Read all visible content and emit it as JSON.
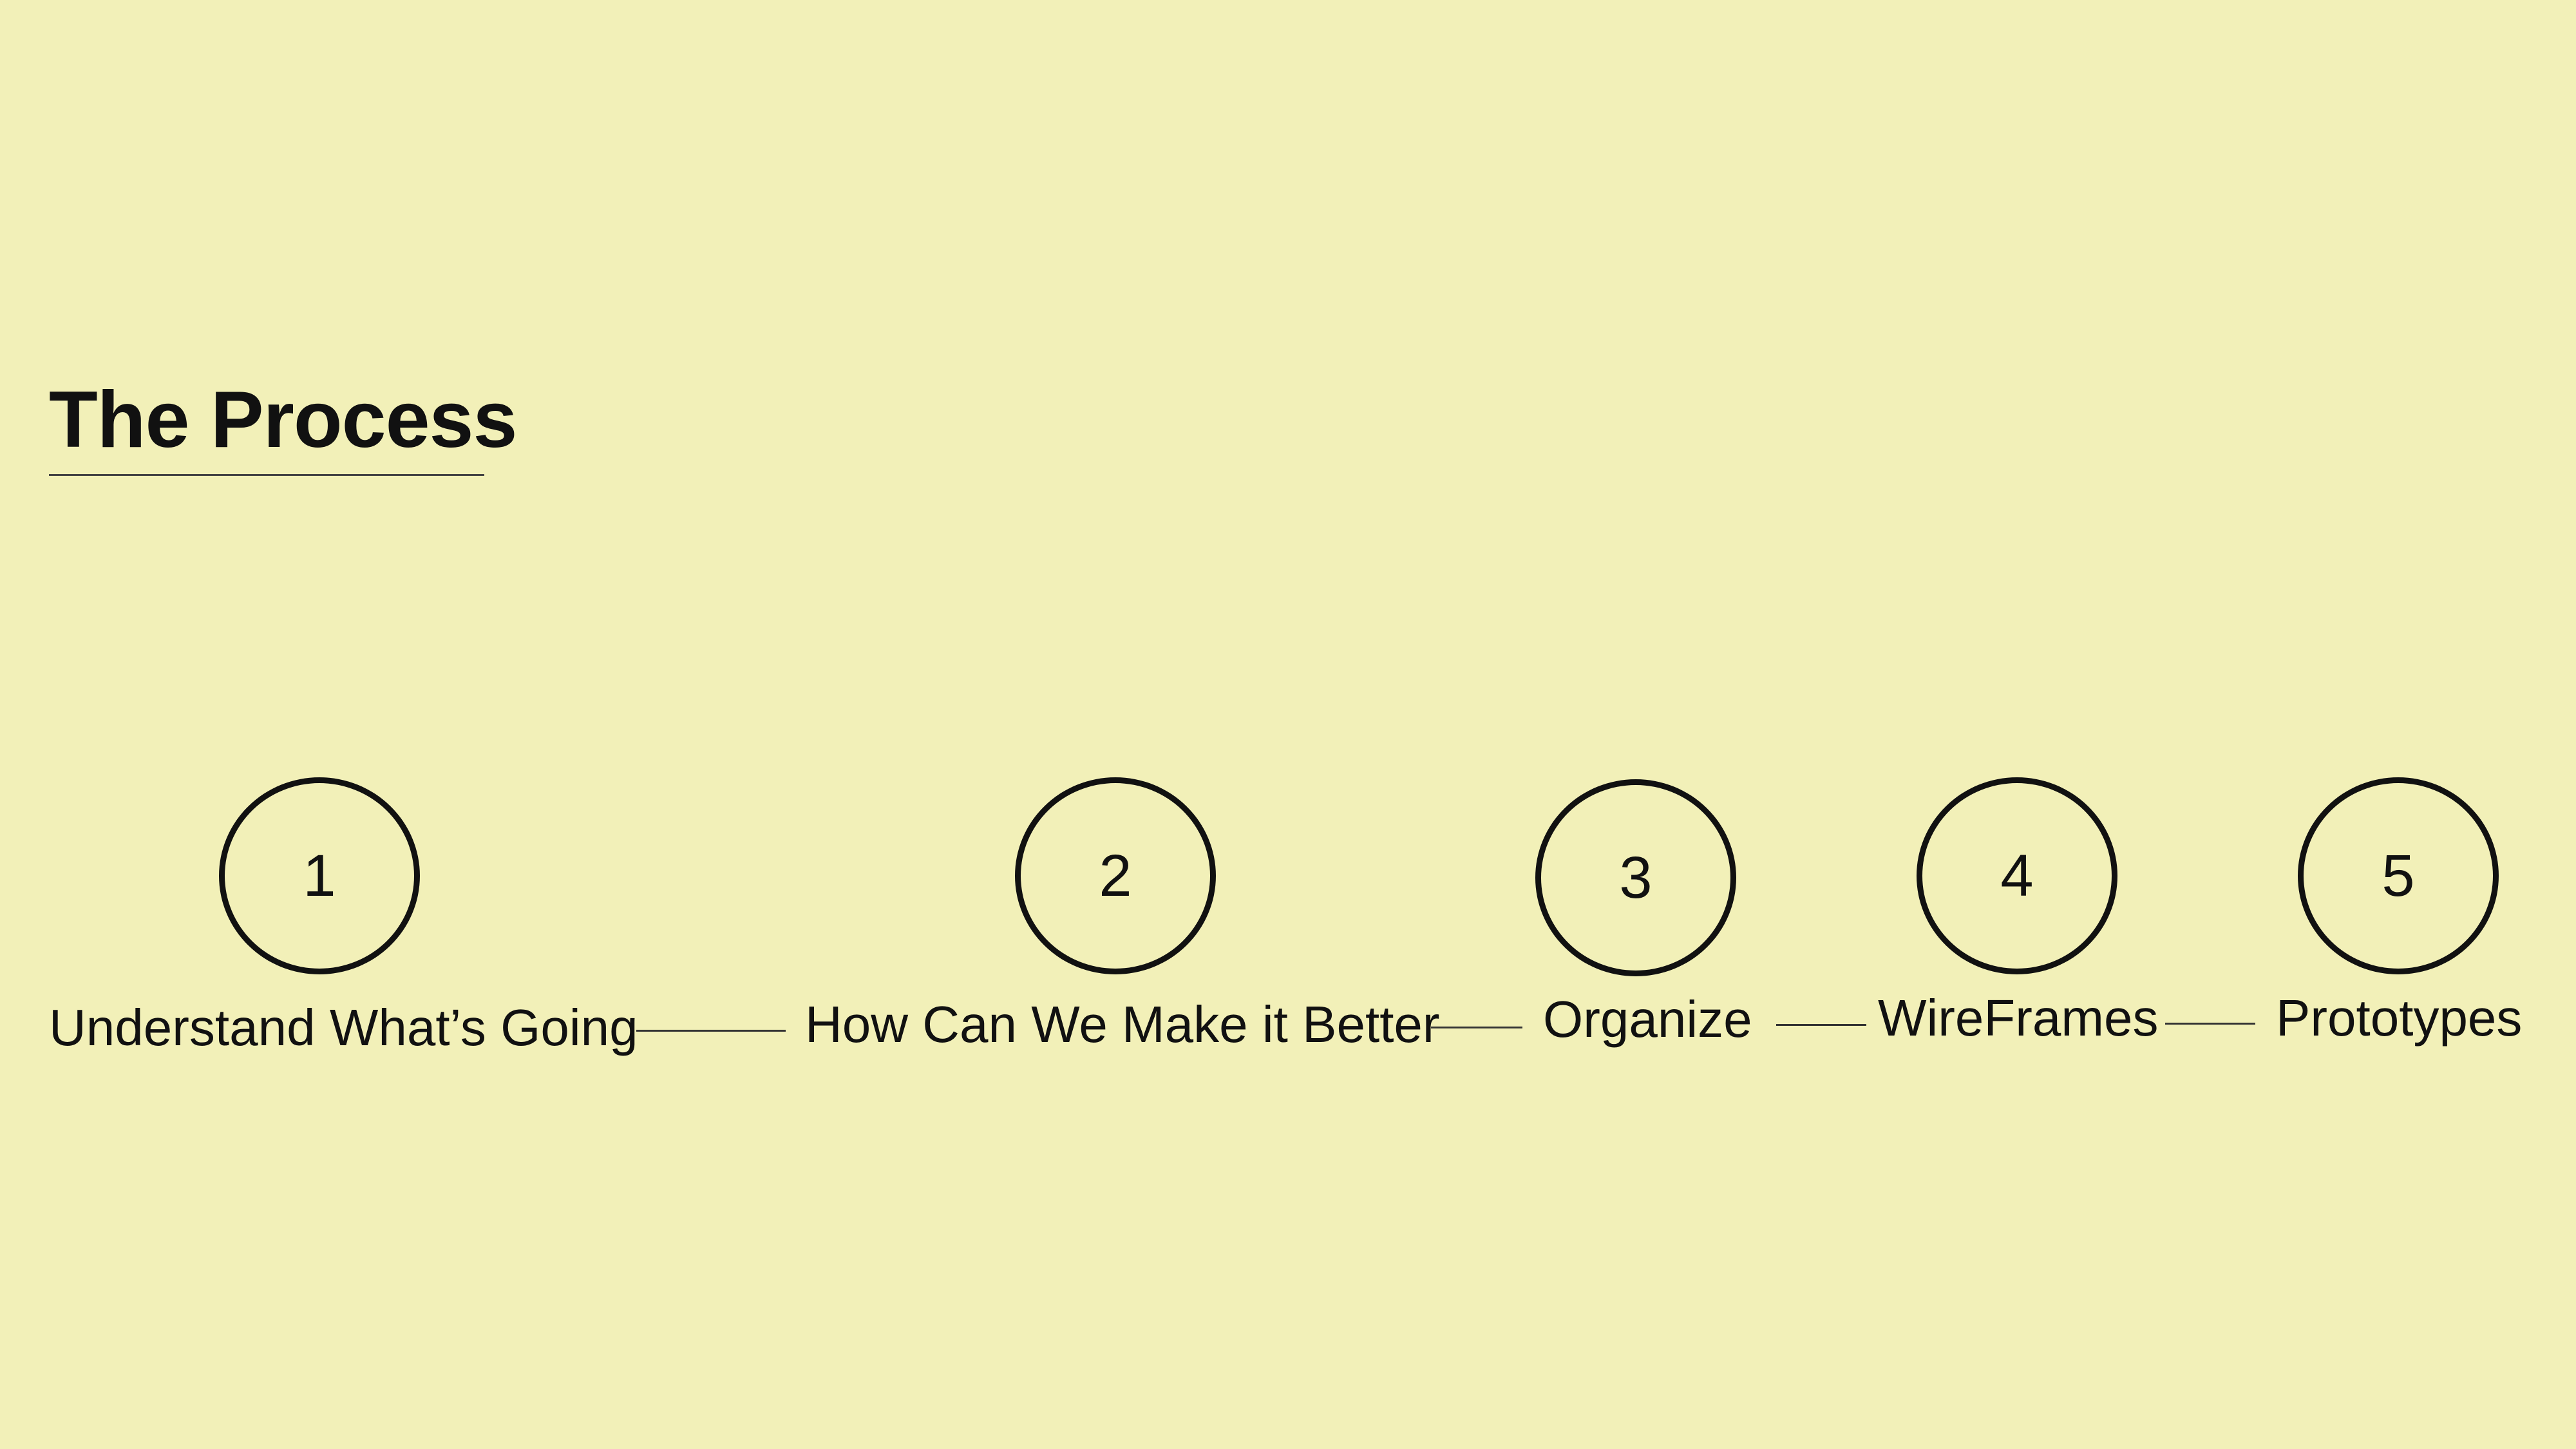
{
  "title": "The Process",
  "steps": [
    {
      "number": "1",
      "label": "Understand What’s Going"
    },
    {
      "number": "2",
      "label": "How Can We Make it Better"
    },
    {
      "number": "3",
      "label": "Organize"
    },
    {
      "number": "4",
      "label": "WireFrames"
    },
    {
      "number": "5",
      "label": "Prototypes"
    }
  ]
}
